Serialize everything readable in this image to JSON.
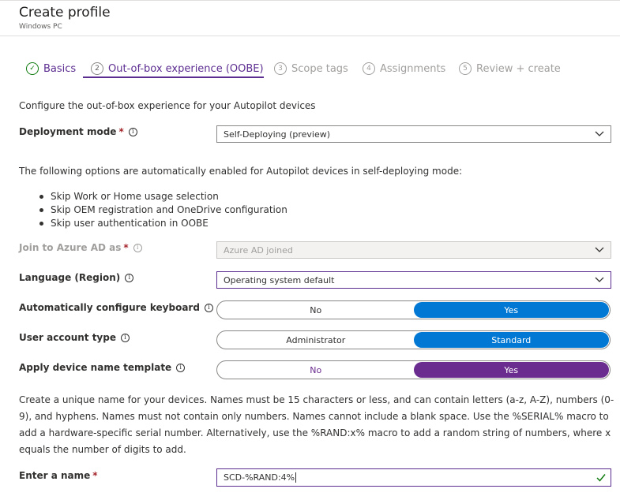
{
  "header": {
    "title": "Create profile",
    "subtitle": "Windows PC"
  },
  "tabs": [
    {
      "number": "✓",
      "label": "Basics",
      "state": "done"
    },
    {
      "number": "2",
      "label": "Out-of-box experience (OOBE)",
      "state": "active"
    },
    {
      "number": "3",
      "label": "Scope tags",
      "state": "future"
    },
    {
      "number": "4",
      "label": "Assignments",
      "state": "future"
    },
    {
      "number": "5",
      "label": "Review + create",
      "state": "future"
    }
  ],
  "intro": "Configure the out-of-box experience for your Autopilot devices",
  "deployment_mode": {
    "label": "Deployment mode",
    "required": "*",
    "value": "Self-Deploying (preview)"
  },
  "auto_options": {
    "text": "The following options are automatically enabled for Autopilot devices in self-deploying mode:",
    "items": [
      "Skip Work or Home usage selection",
      "Skip OEM registration and OneDrive configuration",
      "Skip user authentication in OOBE"
    ]
  },
  "join_azure": {
    "label": "Join to Azure AD as",
    "required": "*",
    "value": "Azure AD joined"
  },
  "language": {
    "label": "Language (Region)",
    "value": "Operating system default"
  },
  "keyboard": {
    "label": "Automatically configure keyboard",
    "left": "No",
    "right": "Yes",
    "selected": "Yes"
  },
  "user_account": {
    "label": "User account type",
    "left": "Administrator",
    "right": "Standard",
    "selected": "Standard"
  },
  "device_name": {
    "label": "Apply device name template",
    "left": "No",
    "right": "Yes",
    "selected": "Yes"
  },
  "name_help": "Create a unique name for your devices. Names must be 15 characters or less, and can contain letters (a-z, A-Z), numbers (0-9), and hyphens. Names must not contain only numbers. Names cannot include a blank space. Use the %SERIAL% macro to add a hardware-specific serial number. Alternatively, use the %RAND:x% macro to add a random string of numbers, where x equals the number of digits to add.",
  "enter_name": {
    "label": "Enter a name",
    "required": "*",
    "value": "SCD-%RAND:4%"
  },
  "colors": {
    "accent": "#5c2d91",
    "toggle_blue": "#0078d4",
    "toggle_purple": "#6b2c8f",
    "success": "#107c10"
  }
}
